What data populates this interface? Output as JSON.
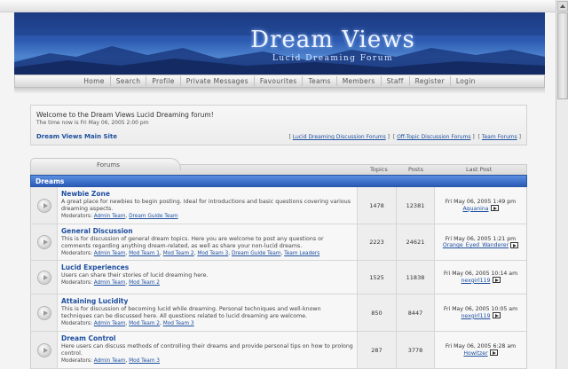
{
  "banner": {
    "title": "Dream Views",
    "subtitle": "Lucid Dreaming Forum"
  },
  "nav": [
    "Home",
    "Search",
    "Profile",
    "Private Messages",
    "Favourites",
    "Teams",
    "Members",
    "Staff",
    "Register",
    "Login"
  ],
  "welcome": {
    "greeting": "Welcome to the Dream Views Lucid Dreaming forum!",
    "time": "The time now is Fri May 06, 2005 2:00 pm",
    "main_site_link": "Dream Views Main Site",
    "links": [
      "Lucid Dreaming Discussion Forums",
      "Off-Topic Discussion Forums",
      "Team Forums"
    ]
  },
  "table": {
    "tab_label": "Forums",
    "col_topics": "Topics",
    "col_posts": "Posts",
    "col_last_post": "Last Post",
    "category": "Dreams",
    "moderators_label": "Moderators",
    "rows": [
      {
        "name": "Newbie Zone",
        "description": "A great place for newbies to begin posting. Ideal for introductions and basic questions covering various dreaming aspects.",
        "moderators": [
          "Admin Team",
          "Dream Guide Team"
        ],
        "topics": "1478",
        "posts": "12381",
        "last_date": "Fri May 06, 2005 1:49 pm",
        "last_user": "Aquanina"
      },
      {
        "name": "General Discussion",
        "description": "This is for discussion of general dream topics. Here you are welcome to post any questions or comments regarding anything dream-related, as well as share your non-lucid dreams.",
        "moderators": [
          "Admin Team",
          "Mod Team 1",
          "Mod Team 2",
          "Mod Team 3",
          "Dream Guide Team",
          "Team Leaders"
        ],
        "topics": "2223",
        "posts": "24621",
        "last_date": "Fri May 06, 2005 1:21 pm",
        "last_user": "Orange_Eyed_Wanderer"
      },
      {
        "name": "Lucid Experiences",
        "description": "Users can share their stories of lucid dreaming here.",
        "moderators": [
          "Admin Team",
          "Mod Team 2"
        ],
        "topics": "1525",
        "posts": "11838",
        "last_date": "Fri May 06, 2005 10:14 am",
        "last_user": "nexgirl119"
      },
      {
        "name": "Attaining Lucidity",
        "description": "This is for discussion of becoming lucid while dreaming. Personal techniques and well-known techniques can be discussed here. All questions related to lucid dreaming are welcome.",
        "moderators": [
          "Admin Team",
          "Mod Team 2",
          "Mod Team 3"
        ],
        "topics": "850",
        "posts": "8447",
        "last_date": "Fri May 06, 2005 10:05 am",
        "last_user": "nexgirl119"
      },
      {
        "name": "Dream Control",
        "description": "Here users can discuss methods of controlling their dreams and provide personal tips on how to prolong control.",
        "moderators": [
          "Admin Team",
          "Mod Team 3"
        ],
        "topics": "287",
        "posts": "3778",
        "last_date": "Fri May 06, 2005 6:28 am",
        "last_user": "Howitzer"
      }
    ]
  },
  "colors": {
    "banner_blue": "#2c5ab0",
    "link_blue": "#1e4fa0",
    "category_bar": "#3d72cc"
  }
}
